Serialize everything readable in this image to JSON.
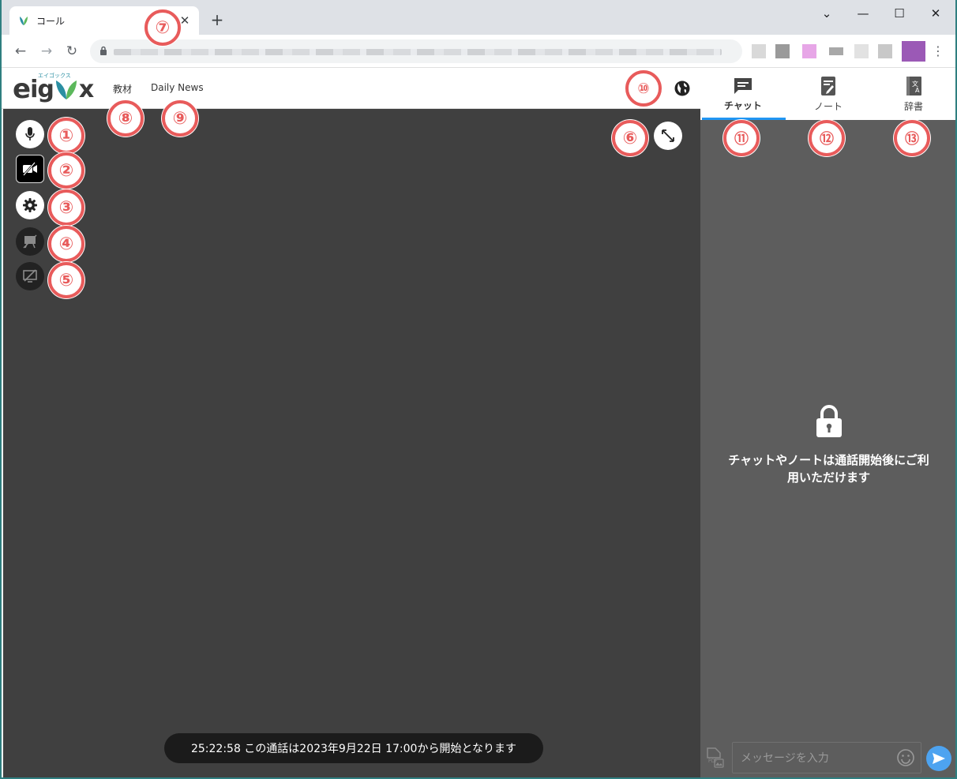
{
  "browser": {
    "tab_title": "コール",
    "close_glyph": "✕",
    "newtab_glyph": "+",
    "window_controls": {
      "dropdown": "⌄",
      "minimize": "—",
      "maximize": "☐",
      "close": "✕"
    },
    "nav": {
      "back": "←",
      "forward": "→",
      "reload": "↻"
    },
    "menu_glyph": "⋮"
  },
  "header": {
    "logo_main": "eigox",
    "logo_kana": "エイゴックス",
    "nav_links": [
      "教材",
      "Daily News"
    ]
  },
  "stage": {
    "status_text": "25:22:58 この通話は2023年9月22日 17:00から開始となります"
  },
  "side_panel": {
    "tabs": [
      {
        "label": "チャット",
        "icon": "chat-icon",
        "active": true
      },
      {
        "label": "ノート",
        "icon": "note-icon",
        "active": false
      },
      {
        "label": "辞書",
        "icon": "dictionary-icon",
        "active": false
      }
    ],
    "locked_message": "チャットやノートは通話開始後にご利用いただけます",
    "input_placeholder": "メッセージを入力"
  },
  "annotations": [
    "①",
    "②",
    "③",
    "④",
    "⑤",
    "⑥",
    "⑦",
    "⑧",
    "⑨",
    "⑩",
    "⑪",
    "⑫",
    "⑬"
  ],
  "colors": {
    "annotation": "#e85b5b",
    "tab_indicator": "#2196f3",
    "stage_bg": "#404040",
    "panel_bg": "#5d5d5d",
    "send_button": "#4da3f0",
    "logo_teal": "#2b8fa3",
    "logo_green": "#5cb85c"
  }
}
